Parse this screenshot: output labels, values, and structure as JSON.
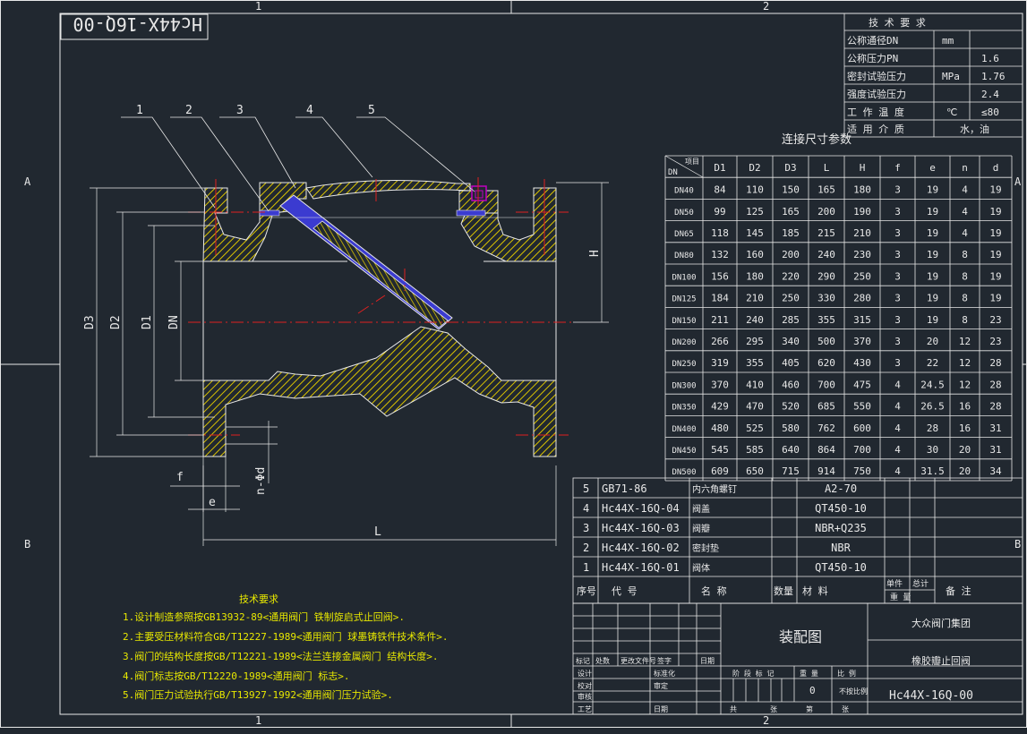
{
  "drawing_number": "Hc44X-16Q-00",
  "zones": {
    "col1": "1",
    "col2": "2",
    "rowA": "A",
    "rowB": "B"
  },
  "balloons": [
    "1",
    "2",
    "3",
    "4",
    "5"
  ],
  "dims": {
    "D3": "D3",
    "D2": "D2",
    "D1": "D1",
    "DN": "DN",
    "H": "H",
    "L": "L",
    "f": "f",
    "e": "e",
    "nd": "n-Φd"
  },
  "tech_table": {
    "title": "技 术 要 求",
    "rows": [
      {
        "label": "公称通径DN",
        "unit": "mm",
        "value": ""
      },
      {
        "label": "公称压力PN",
        "unit": "",
        "value": "1.6"
      },
      {
        "label": "密封试验压力",
        "unit": "MPa",
        "value": "1.76"
      },
      {
        "label": "强度试验压力",
        "unit": "",
        "value": "2.4"
      },
      {
        "label": "工 作 温 度",
        "unit": "℃",
        "value": "≤80"
      },
      {
        "label": "适 用 介 质",
        "unit": "水，油",
        "value": ""
      }
    ]
  },
  "conn_table": {
    "title": "连接尺寸参数",
    "corner_top": "项目",
    "corner_bottom": "DN",
    "headers": [
      "D1",
      "D2",
      "D3",
      "L",
      "H",
      "f",
      "e",
      "n",
      "d"
    ],
    "rows": [
      [
        "DN40",
        "84",
        "110",
        "150",
        "165",
        "180",
        "3",
        "19",
        "4",
        "19"
      ],
      [
        "DN50",
        "99",
        "125",
        "165",
        "200",
        "190",
        "3",
        "19",
        "4",
        "19"
      ],
      [
        "DN65",
        "118",
        "145",
        "185",
        "215",
        "210",
        "3",
        "19",
        "4",
        "19"
      ],
      [
        "DN80",
        "132",
        "160",
        "200",
        "240",
        "230",
        "3",
        "19",
        "8",
        "19"
      ],
      [
        "DN100",
        "156",
        "180",
        "220",
        "290",
        "250",
        "3",
        "19",
        "8",
        "19"
      ],
      [
        "DN125",
        "184",
        "210",
        "250",
        "330",
        "280",
        "3",
        "19",
        "8",
        "19"
      ],
      [
        "DN150",
        "211",
        "240",
        "285",
        "355",
        "315",
        "3",
        "19",
        "8",
        "23"
      ],
      [
        "DN200",
        "266",
        "295",
        "340",
        "500",
        "370",
        "3",
        "20",
        "12",
        "23"
      ],
      [
        "DN250",
        "319",
        "355",
        "405",
        "620",
        "430",
        "3",
        "22",
        "12",
        "28"
      ],
      [
        "DN300",
        "370",
        "410",
        "460",
        "700",
        "475",
        "4",
        "24.5",
        "12",
        "28"
      ],
      [
        "DN350",
        "429",
        "470",
        "520",
        "685",
        "550",
        "4",
        "26.5",
        "16",
        "28"
      ],
      [
        "DN400",
        "480",
        "525",
        "580",
        "762",
        "600",
        "4",
        "28",
        "16",
        "31"
      ],
      [
        "DN450",
        "545",
        "585",
        "640",
        "864",
        "700",
        "4",
        "30",
        "20",
        "31"
      ],
      [
        "DN500",
        "609",
        "650",
        "715",
        "914",
        "750",
        "4",
        "31.5",
        "20",
        "34"
      ]
    ]
  },
  "bom": {
    "rows": [
      {
        "no": "5",
        "code": "GB71-86",
        "name": "内六角螺钉",
        "qty": "",
        "material": "A2-70"
      },
      {
        "no": "4",
        "code": "Hc44X-16Q-04",
        "name": "阀盖",
        "qty": "",
        "material": "QT450-10"
      },
      {
        "no": "3",
        "code": "Hc44X-16Q-03",
        "name": "阀瓣",
        "qty": "",
        "material": "NBR+Q235"
      },
      {
        "no": "2",
        "code": "Hc44X-16Q-02",
        "name": "密封垫",
        "qty": "",
        "material": "NBR"
      },
      {
        "no": "1",
        "code": "Hc44X-16Q-01",
        "name": "阀体",
        "qty": "",
        "material": "QT450-10"
      }
    ],
    "header": {
      "no": "序号",
      "code": "代    号",
      "name": "名    称",
      "qty": "数量",
      "material": "材    料",
      "unit": "单件",
      "total": "总计",
      "weight": "重    量",
      "remark": "备    注"
    }
  },
  "notes": {
    "title": "技术要求",
    "items": [
      "1.设计制造参照按GB13932-89<通用阀门 铁制旋启式止回阀>.",
      "2.主要受压材料符合GB/T12227-1989<通用阀门 球墨铸铁件技术条件>.",
      "3.阀门的结构长度按GB/T12221-1989<法兰连接金属阀门 结构长度>.",
      "4.阀门标志按GB/T12220-1989<通用阀门 标志>.",
      "5.阀门压力试验执行GB/T13927-1992<通用阀门压力试验>."
    ]
  },
  "title_block": {
    "drawing_name": "装配图",
    "company": "大众阀门集团",
    "product": "橡胶瓣止回阀",
    "number": "Hc44X-16Q-00",
    "mark": "标记",
    "count": "处数",
    "change_file": "更改文件号",
    "sign": "签字",
    "date": "日期",
    "design": "设计",
    "standard": "标准化",
    "check": "校对",
    "review": "审定",
    "audit": "审核",
    "craft": "工艺",
    "stage": "阶 段 标 记",
    "weight": "重 量",
    "scale": "比 例",
    "weight_val": "0",
    "scale_val": "不按比例",
    "total_sheets": "共",
    "sheet_unit": "张",
    "sheet_no": "第",
    "sheet_unit2": "张"
  },
  "colors": {
    "bg": "#212830",
    "line": "#e8e8e8",
    "section": "#d9c200",
    "center": "#e02020",
    "dim": "#e8e8e8",
    "outline": "#ffffff",
    "accent": "#c000c0"
  }
}
